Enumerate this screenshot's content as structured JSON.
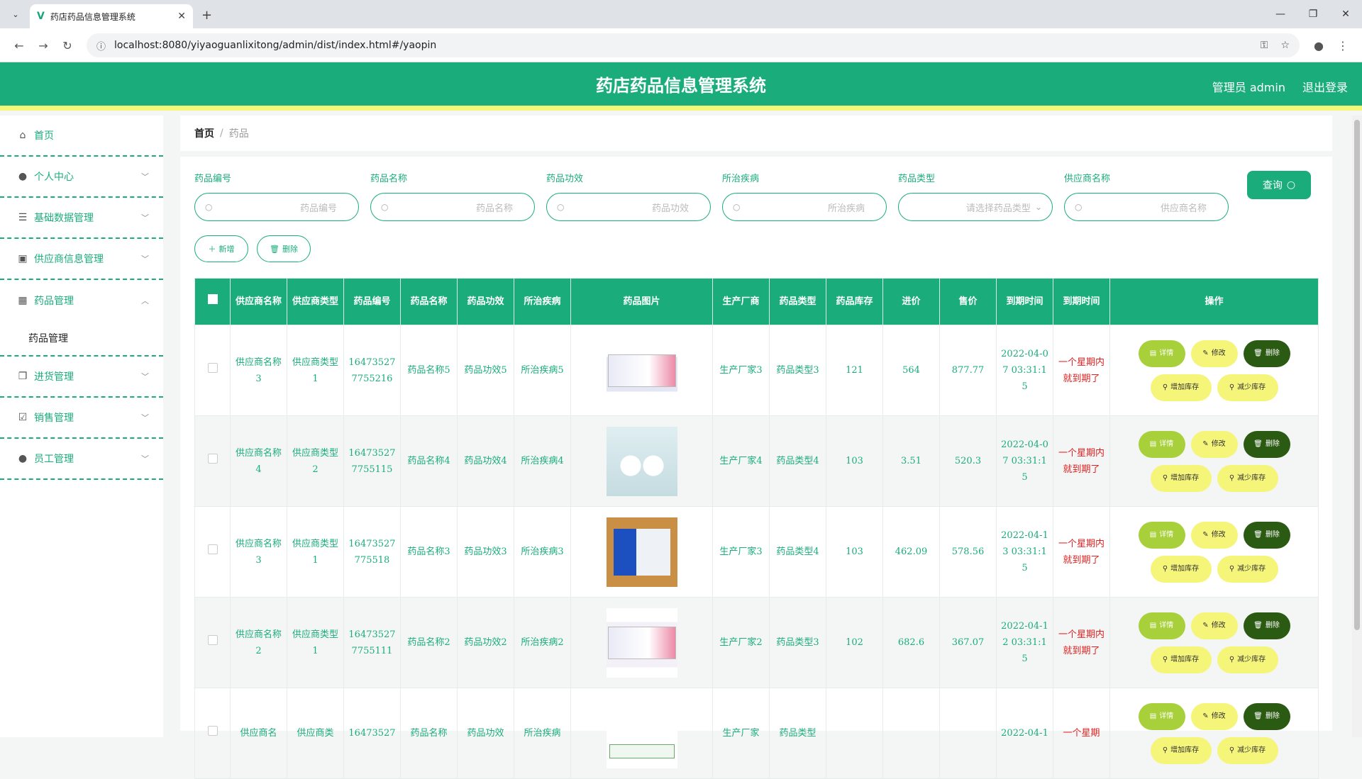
{
  "browser": {
    "tab_title": "药店药品信息管理系统",
    "url": "localhost:8080/yiyaoguanlixitong/admin/dist/index.html#/yaopin"
  },
  "header": {
    "title": "药店药品信息管理系统",
    "user": "管理员 admin",
    "logout": "退出登录"
  },
  "sidebar": {
    "items": [
      {
        "label": "首页",
        "icon": "home-icon"
      },
      {
        "label": "个人中心",
        "icon": "person-icon"
      },
      {
        "label": "基础数据管理",
        "icon": "list-icon"
      },
      {
        "label": "供应商信息管理",
        "icon": "wallet-icon"
      },
      {
        "label": "药品管理",
        "icon": "grid-icon"
      },
      {
        "label": "药品管理",
        "sub": true
      },
      {
        "label": "进货管理",
        "icon": "copy-icon"
      },
      {
        "label": "销售管理",
        "icon": "checkbox-icon"
      },
      {
        "label": "员工管理",
        "icon": "person-icon"
      }
    ]
  },
  "breadcrumb": {
    "home": "首页",
    "current": "药品"
  },
  "filters": [
    {
      "label": "药品编号",
      "placeholder": "药品编号"
    },
    {
      "label": "药品名称",
      "placeholder": "药品名称"
    },
    {
      "label": "药品功效",
      "placeholder": "药品功效"
    },
    {
      "label": "所治疾病",
      "placeholder": "所治疾病"
    },
    {
      "label": "药品类型",
      "placeholder": "请选择药品类型"
    },
    {
      "label": "供应商名称",
      "placeholder": "供应商名称"
    }
  ],
  "query_label": "查询",
  "actions": {
    "add": "新增",
    "delete": "删除"
  },
  "columns": [
    "供应商名称",
    "供应商类型",
    "药品编号",
    "药品名称",
    "药品功效",
    "所治疾病",
    "药品图片",
    "生产厂商",
    "药品类型",
    "药品库存",
    "进价",
    "售价",
    "到期时间",
    "到期时间",
    "操作"
  ],
  "row_ops": {
    "detail": "详情",
    "edit": "修改",
    "delete": "删除",
    "inc": "增加库存",
    "dec": "减少库存"
  },
  "rows": [
    {
      "supplier": "供应商名称3",
      "stype": "供应商类型1",
      "code": "164735277755216",
      "name": "药品名称5",
      "effect": "药品功效5",
      "disease": "所治疾病5",
      "maker": "生产厂家3",
      "type": "药品类型3",
      "stock": "121",
      "cost": "564",
      "price": "877.77",
      "expire": "2022-04-07 03:31:15",
      "warn": "一个星期内就到期了"
    },
    {
      "supplier": "供应商名称4",
      "stype": "供应商类型2",
      "code": "164735277755115",
      "name": "药品名称4",
      "effect": "药品功效4",
      "disease": "所治疾病4",
      "maker": "生产厂家4",
      "type": "药品类型4",
      "stock": "103",
      "cost": "3.51",
      "price": "520.3",
      "expire": "2022-04-07 03:31:15",
      "warn": "一个星期内就到期了"
    },
    {
      "supplier": "供应商名称3",
      "stype": "供应商类型1",
      "code": "16473527775518",
      "name": "药品名称3",
      "effect": "药品功效3",
      "disease": "所治疾病3",
      "maker": "生产厂家3",
      "type": "药品类型4",
      "stock": "103",
      "cost": "462.09",
      "price": "578.56",
      "expire": "2022-04-13 03:31:15",
      "warn": "一个星期内就到期了"
    },
    {
      "supplier": "供应商名称2",
      "stype": "供应商类型1",
      "code": "164735277755111",
      "name": "药品名称2",
      "effect": "药品功效2",
      "disease": "所治疾病2",
      "maker": "生产厂家2",
      "type": "药品类型3",
      "stock": "102",
      "cost": "682.6",
      "price": "367.07",
      "expire": "2022-04-12 03:31:15",
      "warn": "一个星期内就到期了"
    },
    {
      "supplier": "供应商名",
      "stype": "供应商类",
      "code": "16473527",
      "name": "药品名称",
      "effect": "药品功效",
      "disease": "所治疾病",
      "maker": "生产厂家",
      "type": "药品类型",
      "stock": "",
      "cost": "",
      "price": "",
      "expire": "2022-04-1",
      "warn": "一个星期"
    }
  ]
}
